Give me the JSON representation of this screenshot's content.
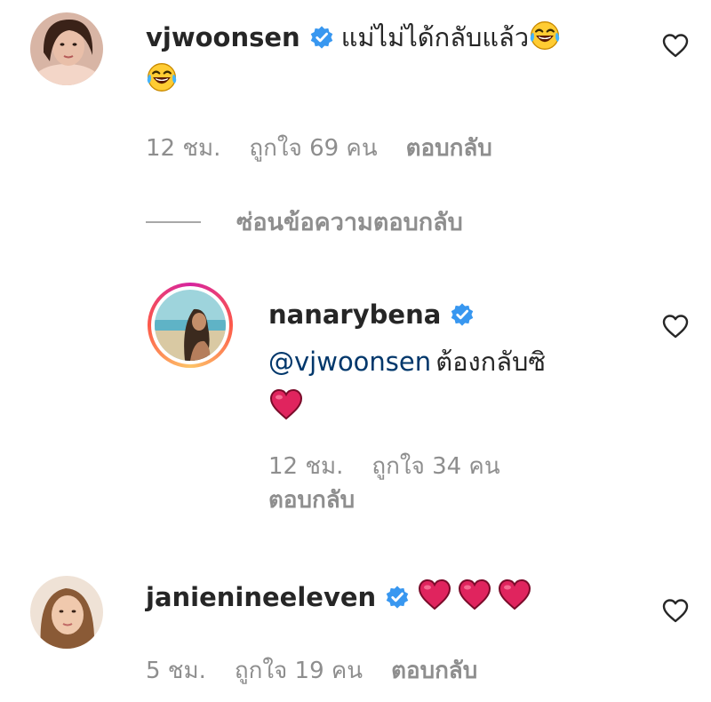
{
  "comments": [
    {
      "username": "vjwoonsen",
      "text": "แม่ไม่ได้กลับแล้ว",
      "time": "12 ชม.",
      "likes": "ถูกใจ 69 คน",
      "reply": "ตอบกลับ"
    }
  ],
  "hide_replies": "ซ่อนข้อความตอบกลับ",
  "reply_comment": {
    "username": "nanarybena",
    "mention": "@vjwoonsen",
    "text": "ต้องกลับซิ",
    "time": "12 ชม.",
    "likes": "ถูกใจ 34 คน",
    "reply": "ตอบกลับ"
  },
  "comment3": {
    "username": "janienineeleven",
    "time": "5 ชม.",
    "likes": "ถูกใจ 19 คน",
    "reply": "ตอบกลับ"
  },
  "colors": {
    "verified": "#3897f0",
    "heart_emoji": "#e0245e",
    "mention": "#00376b",
    "meta": "#8e8e8e"
  },
  "icons": [
    "verified-badge-icon",
    "like-heart-icon",
    "laughing-emoji-icon",
    "red-heart-emoji-icon"
  ]
}
